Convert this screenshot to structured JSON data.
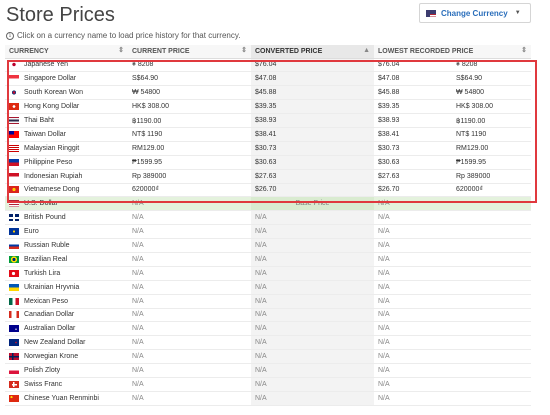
{
  "page": {
    "title": "Store Prices"
  },
  "currency_button": {
    "label": "Change Currency",
    "flag": "us-flag"
  },
  "info": {
    "text": "Click on a currency name to load price history for that currency."
  },
  "table": {
    "headers": [
      "CURRENCY",
      "CURRENT PRICE",
      "CONVERTED PRICE",
      "LOWEST RECORDED PRICE"
    ],
    "sorted_column": "CONVERTED PRICE",
    "base_label": "Base Price",
    "rows": [
      {
        "currency": "Japanese Yen",
        "flag": "jp",
        "current": "¥ 8208",
        "converted": "$76.04",
        "lowest_usd": "$76.04",
        "lowest_local": "¥ 8208"
      },
      {
        "currency": "Singapore Dollar",
        "flag": "sg",
        "current": "S$64.90",
        "converted": "$47.08",
        "lowest_usd": "$47.08",
        "lowest_local": "S$64.90"
      },
      {
        "currency": "South Korean Won",
        "flag": "kr",
        "current": "₩ 54800",
        "converted": "$45.88",
        "lowest_usd": "$45.88",
        "lowest_local": "₩ 54800"
      },
      {
        "currency": "Hong Kong Dollar",
        "flag": "hk",
        "current": "HK$ 308.00",
        "converted": "$39.35",
        "lowest_usd": "$39.35",
        "lowest_local": "HK$ 308.00"
      },
      {
        "currency": "Thai Baht",
        "flag": "th",
        "current": "฿1190.00",
        "converted": "$38.93",
        "lowest_usd": "$38.93",
        "lowest_local": "฿1190.00"
      },
      {
        "currency": "Taiwan Dollar",
        "flag": "tw",
        "current": "NT$ 1190",
        "converted": "$38.41",
        "lowest_usd": "$38.41",
        "lowest_local": "NT$ 1190"
      },
      {
        "currency": "Malaysian Ringgit",
        "flag": "my",
        "current": "RM129.00",
        "converted": "$30.73",
        "lowest_usd": "$30.73",
        "lowest_local": "RM129.00"
      },
      {
        "currency": "Philippine Peso",
        "flag": "ph",
        "current": "₱1599.95",
        "converted": "$30.63",
        "lowest_usd": "$30.63",
        "lowest_local": "₱1599.95"
      },
      {
        "currency": "Indonesian Rupiah",
        "flag": "id",
        "current": "Rp 389000",
        "converted": "$27.63",
        "lowest_usd": "$27.63",
        "lowest_local": "Rp 389000"
      },
      {
        "currency": "Vietnamese Dong",
        "flag": "vn",
        "current": "620000₫",
        "converted": "$26.70",
        "lowest_usd": "$26.70",
        "lowest_local": "620000₫"
      },
      {
        "currency": "U.S. Dollar",
        "flag": "us",
        "base": true,
        "current": "N/A",
        "converted": "",
        "lowest_usd": "N/A",
        "lowest_local": ""
      },
      {
        "currency": "British Pound",
        "flag": "gb",
        "current": "N/A",
        "converted": "N/A",
        "lowest_usd": "N/A",
        "lowest_local": ""
      },
      {
        "currency": "Euro",
        "flag": "eu",
        "current": "N/A",
        "converted": "N/A",
        "lowest_usd": "N/A",
        "lowest_local": ""
      },
      {
        "currency": "Russian Ruble",
        "flag": "ru",
        "current": "N/A",
        "converted": "N/A",
        "lowest_usd": "N/A",
        "lowest_local": ""
      },
      {
        "currency": "Brazilian Real",
        "flag": "br",
        "current": "N/A",
        "converted": "N/A",
        "lowest_usd": "N/A",
        "lowest_local": ""
      },
      {
        "currency": "Turkish Lira",
        "flag": "tr",
        "current": "N/A",
        "converted": "N/A",
        "lowest_usd": "N/A",
        "lowest_local": ""
      },
      {
        "currency": "Ukrainian Hryvnia",
        "flag": "ua",
        "current": "N/A",
        "converted": "N/A",
        "lowest_usd": "N/A",
        "lowest_local": ""
      },
      {
        "currency": "Mexican Peso",
        "flag": "mx",
        "current": "N/A",
        "converted": "N/A",
        "lowest_usd": "N/A",
        "lowest_local": ""
      },
      {
        "currency": "Canadian Dollar",
        "flag": "ca",
        "current": "N/A",
        "converted": "N/A",
        "lowest_usd": "N/A",
        "lowest_local": ""
      },
      {
        "currency": "Australian Dollar",
        "flag": "au",
        "current": "N/A",
        "converted": "N/A",
        "lowest_usd": "N/A",
        "lowest_local": ""
      },
      {
        "currency": "New Zealand Dollar",
        "flag": "nz",
        "current": "N/A",
        "converted": "N/A",
        "lowest_usd": "N/A",
        "lowest_local": ""
      },
      {
        "currency": "Norwegian Krone",
        "flag": "no",
        "current": "N/A",
        "converted": "N/A",
        "lowest_usd": "N/A",
        "lowest_local": ""
      },
      {
        "currency": "Polish Zloty",
        "flag": "pl",
        "current": "N/A",
        "converted": "N/A",
        "lowest_usd": "N/A",
        "lowest_local": ""
      },
      {
        "currency": "Swiss Franc",
        "flag": "ch",
        "current": "N/A",
        "converted": "N/A",
        "lowest_usd": "N/A",
        "lowest_local": ""
      },
      {
        "currency": "Chinese Yuan Renminbi",
        "flag": "cn",
        "current": "N/A",
        "converted": "N/A",
        "lowest_usd": "N/A",
        "lowest_local": ""
      }
    ]
  },
  "colors": {
    "accent": "#2a6ebb",
    "highlight": "#e0393e",
    "base_row": "#e4f2dd"
  }
}
